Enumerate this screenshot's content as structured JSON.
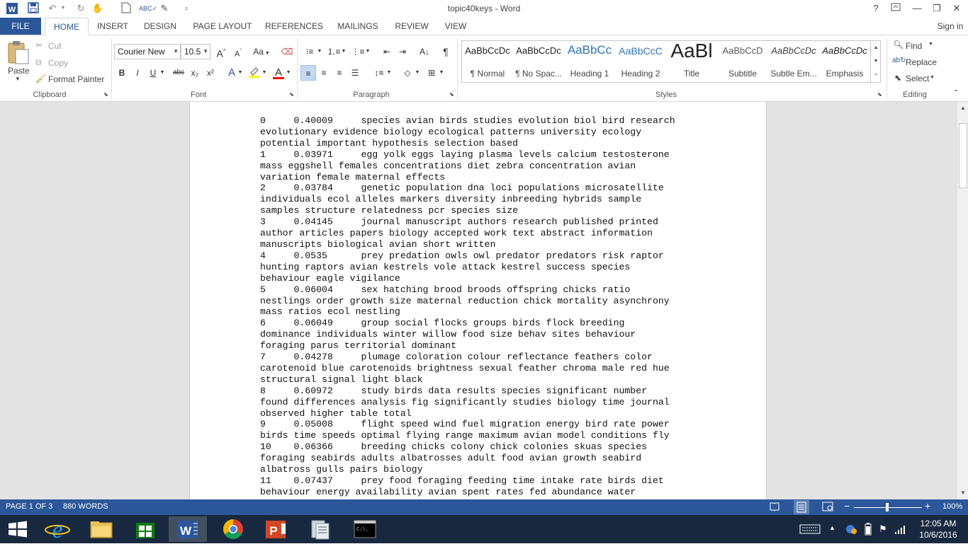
{
  "window": {
    "title": "topic40keys - Word",
    "help": "?"
  },
  "tabs": {
    "file": "FILE",
    "home": "HOME",
    "insert": "INSERT",
    "design": "DESIGN",
    "page_layout": "PAGE LAYOUT",
    "references": "REFERENCES",
    "mailings": "MAILINGS",
    "review": "REVIEW",
    "view": "VIEW",
    "sign_in": "Sign in"
  },
  "clipboard": {
    "paste": "Paste",
    "cut": "Cut",
    "copy": "Copy",
    "format_painter": "Format Painter",
    "group_label": "Clipboard"
  },
  "font": {
    "name": "Courier New",
    "size": "10.5",
    "bold": "B",
    "italic": "I",
    "underline": "U",
    "strike": "abc",
    "subscript": "x₂",
    "superscript": "x²",
    "change_case": "Aa",
    "font_color": "A",
    "highlight_color": "#ffff00",
    "font_color_value": "#ff0000",
    "group_label": "Font"
  },
  "paragraph": {
    "group_label": "Paragraph"
  },
  "styles": {
    "group_label": "Styles",
    "items": [
      {
        "sample": "AaBbCcDc",
        "name": "¶ Normal"
      },
      {
        "sample": "AaBbCcDc",
        "name": "¶ No Spac..."
      },
      {
        "sample": "AaBbCc",
        "name": "Heading 1"
      },
      {
        "sample": "AaBbCcC",
        "name": "Heading 2"
      },
      {
        "sample": "AaBl",
        "name": "Title"
      },
      {
        "sample": "AaBbCcD",
        "name": "Subtitle"
      },
      {
        "sample": "AaBbCcDc",
        "name": "Subtle Em..."
      },
      {
        "sample": "AaBbCcDc",
        "name": "Emphasis"
      }
    ]
  },
  "editing": {
    "find": "Find",
    "replace": "Replace",
    "select": "Select",
    "group_label": "Editing"
  },
  "document": {
    "paragraphs": [
      "0\t0.40009\tspecies avian birds studies evolution biol bird research evolutionary evidence biology ecological patterns university ecology potential important hypothesis selection based",
      "1\t0.03971\tegg yolk eggs laying plasma levels calcium testosterone mass eggshell females concentrations diet zebra concentration avian variation female maternal effects",
      "2\t0.03784\tgenetic population dna loci populations microsatellite individuals ecol alleles markers diversity inbreeding hybrids sample samples structure relatedness pcr species size",
      "3\t0.04145\tjournal manuscript authors research published printed author articles papers biology accepted work text abstract information manuscripts biological avian short written",
      "4\t0.0535\tprey predation owls owl predator predators risk raptor hunting raptors avian kestrels vole attack kestrel success species behaviour eagle vigilance",
      "5\t0.06004\tsex hatching brood broods offspring chicks ratio nestlings order growth size maternal reduction chick mortality asynchrony mass ratios ecol nestling",
      "6\t0.06049\tgroup social flocks groups birds flock breeding dominance individuals winter willow food size behav sites behaviour foraging parus territorial dominant",
      "7\t0.04278\tplumage coloration colour reflectance feathers color carotenoid blue carotenoids brightness sexual feather chroma male red hue structural signal light black",
      "8\t0.60972\tstudy birds data results species significant number found differences analysis fig significantly studies biology time journal observed higher table total",
      "9\t0.05008\tflight speed wind fuel migration energy bird rate power birds time speeds optimal flying range maximum avian model conditions fly",
      "10\t0.06366\tbreeding chicks colony chick colonies skuas species foraging seabirds adults albatrosses adult food avian growth seabird albatross gulls pairs biology",
      "11\t0.07437\tprey food foraging feeding time intake rate birds diet behaviour energy availability avian spent rates fed abundance water"
    ]
  },
  "status": {
    "page": "PAGE 1 OF 3",
    "words": "880 WORDS",
    "zoom": "100%"
  },
  "taskbar": {
    "time": "12:05 AM",
    "date": "10/6/2016"
  },
  "colors": {
    "accent": "#2b579a",
    "taskbar": "#18293f"
  }
}
